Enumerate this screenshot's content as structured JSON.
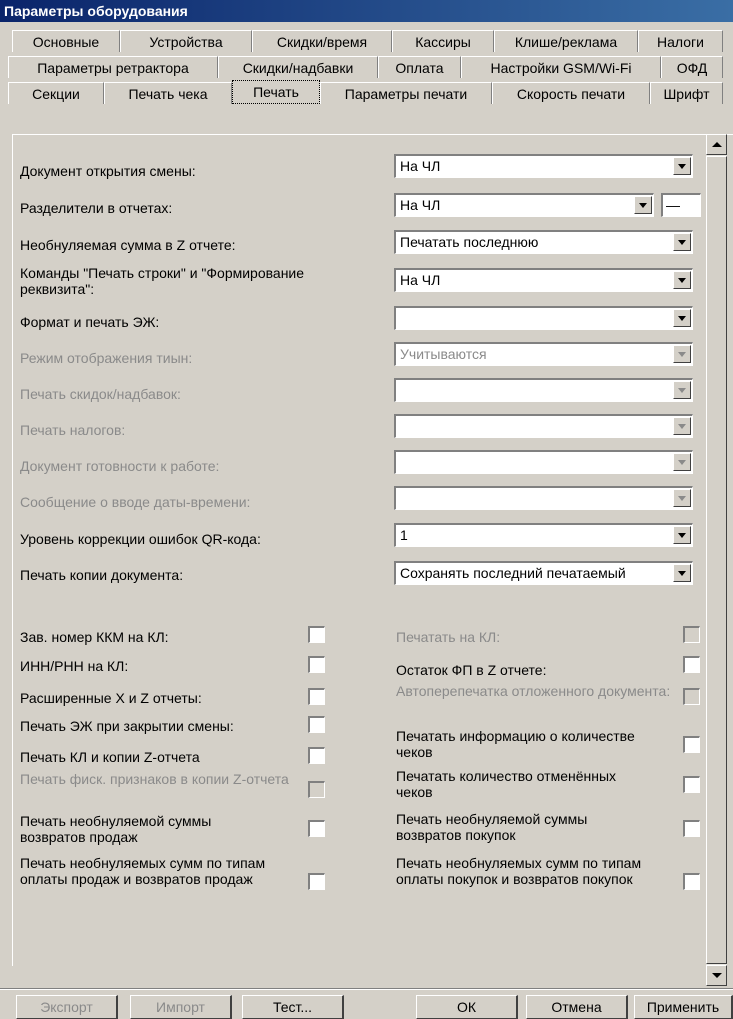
{
  "window": {
    "title": "Параметры оборудования"
  },
  "tabs": {
    "row1": [
      "Основные",
      "Устройства",
      "Скидки/время",
      "Кассиры",
      "Клише/реклама",
      "Налоги"
    ],
    "row2": [
      "Параметры ретрактора",
      "Скидки/надбавки",
      "Оплата",
      "Настройки GSM/Wi-Fi",
      "ОФД"
    ],
    "row3": [
      "Секции",
      "Печать чека",
      "Печать",
      "Параметры печати",
      "Скорость печати",
      "Шрифт"
    ],
    "active": "Печать"
  },
  "settings": [
    {
      "label": "Документ открытия смены:",
      "value": "На ЧЛ",
      "enabled": true
    },
    {
      "label": "Разделители в отчетах:",
      "value": "На ЧЛ",
      "enabled": true,
      "extra": "—"
    },
    {
      "label": "Необнуляемая сумма в Z отчете:",
      "value": "Печатать последнюю",
      "enabled": true
    },
    {
      "label": "Команды \"Печать строки\" и \"Формирование реквизита\":",
      "value": "На ЧЛ",
      "enabled": true
    },
    {
      "label": "Формат и печать ЭЖ:",
      "value": "",
      "enabled": true
    },
    {
      "label": "Режим отображения тиын:",
      "value": "Учитываются",
      "enabled": false
    },
    {
      "label": "Печать скидок/надбавок:",
      "value": "",
      "enabled": false
    },
    {
      "label": "Печать налогов:",
      "value": "",
      "enabled": false
    },
    {
      "label": "Документ готовности к работе:",
      "value": "",
      "enabled": false
    },
    {
      "label": "Сообщение о вводе даты-времени:",
      "value": "",
      "enabled": false
    },
    {
      "label": "Уровень коррекции ошибок QR-кода:",
      "value": "1",
      "enabled": true
    },
    {
      "label": "Печать копии документа:",
      "value": "Сохранять последний печатаемый",
      "enabled": true
    }
  ],
  "checkboxes_left": [
    {
      "label": "Зав. номер ККМ на КЛ:",
      "checked": false,
      "enabled": true
    },
    {
      "label": "ИНН/РНН на КЛ:",
      "checked": false,
      "enabled": true
    },
    {
      "label": "Расширенные X и Z отчеты:",
      "checked": false,
      "enabled": true
    },
    {
      "label": "Печать ЭЖ при закрытии смены:",
      "checked": false,
      "enabled": true
    },
    {
      "label": "Печать КЛ и копии Z-отчета",
      "checked": false,
      "enabled": true
    },
    {
      "label": "Печать фиск. признаков в копии Z-отчета",
      "checked": false,
      "enabled": false
    },
    {
      "label": "Печать необнуляемой суммы возвратов продаж",
      "checked": false,
      "enabled": true
    },
    {
      "label": "Печать необнуляемых сумм по типам оплаты продаж и возвратов продаж",
      "checked": false,
      "enabled": true
    }
  ],
  "checkboxes_right": [
    {
      "label": "Печатать на КЛ:",
      "checked": false,
      "enabled": false
    },
    {
      "label": "Остаток ФП в Z отчете:",
      "checked": false,
      "enabled": true
    },
    {
      "label": "Автоперепечатка отложенного документа:",
      "checked": false,
      "enabled": false
    },
    {
      "label": "Печатать информацию о количестве чеков",
      "checked": false,
      "enabled": true
    },
    {
      "label": "Печатать количество отменённых чеков",
      "checked": false,
      "enabled": true
    },
    {
      "label": "Печать необнуляемой суммы возвратов покупок",
      "checked": false,
      "enabled": true
    },
    {
      "label": "Печать необнуляемых сумм по типам оплаты покупок и возвратов покупок",
      "checked": false,
      "enabled": true
    }
  ],
  "buttons": {
    "export": "Экспорт",
    "import": "Импорт",
    "test": "Тест...",
    "ok": "ОК",
    "cancel": "Отмена",
    "apply": "Применить"
  }
}
